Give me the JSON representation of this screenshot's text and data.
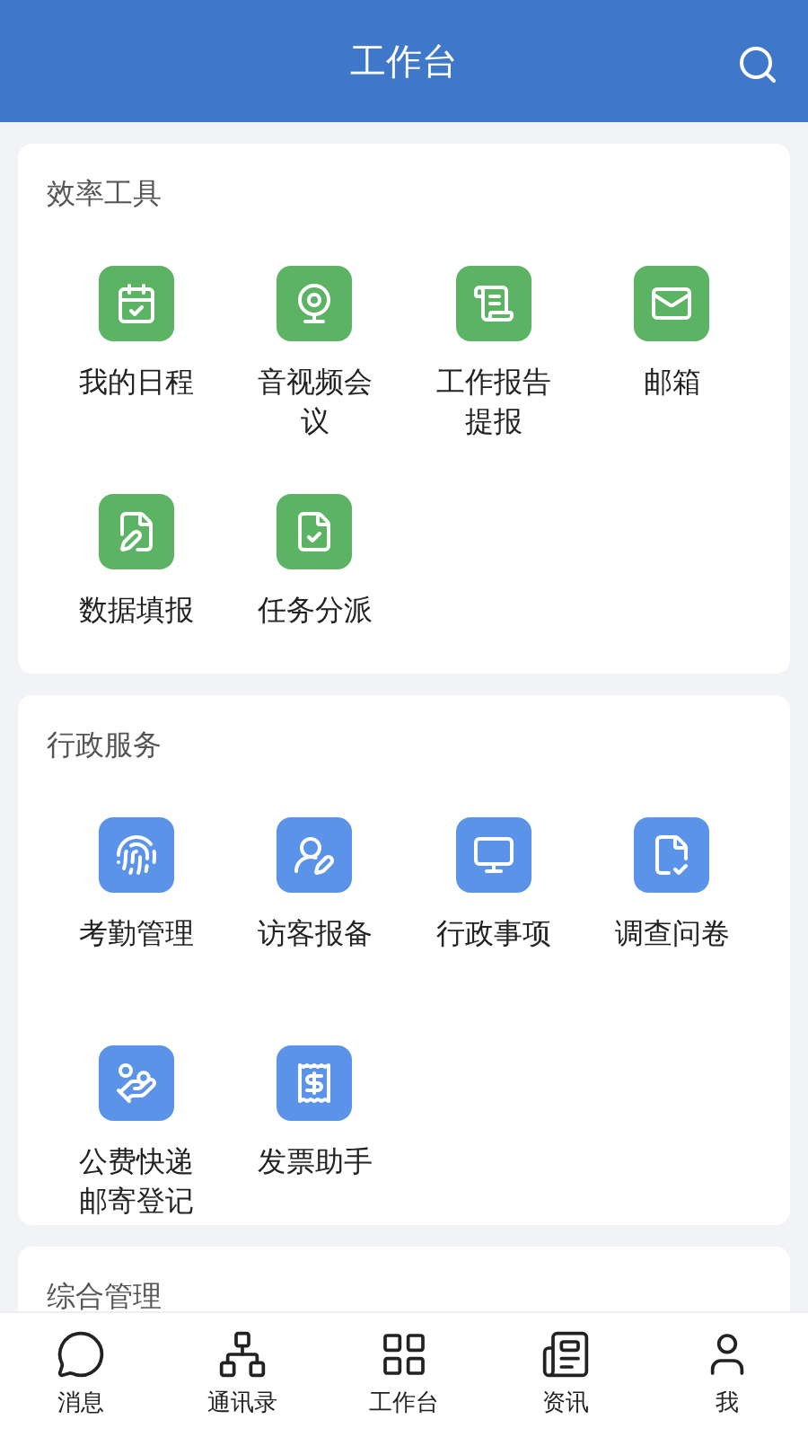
{
  "header": {
    "title": "工作台"
  },
  "sections": [
    {
      "title": "效率工具",
      "color": "#5cb363",
      "items": [
        {
          "label": "我的日程"
        },
        {
          "label": "音视频会议"
        },
        {
          "label": "工作报告提报"
        },
        {
          "label": "邮箱"
        },
        {
          "label": "数据填报"
        },
        {
          "label": "任务分派"
        }
      ]
    },
    {
      "title": "行政服务",
      "color": "#5b93e8",
      "items": [
        {
          "label": "考勤管理"
        },
        {
          "label": "访客报备"
        },
        {
          "label": "行政事项"
        },
        {
          "label": "调查问卷"
        },
        {
          "label": "公费快递邮寄登记"
        },
        {
          "label": "发票助手"
        }
      ]
    },
    {
      "title": "综合管理"
    }
  ],
  "tabbar": [
    {
      "label": "消息",
      "selected": false
    },
    {
      "label": "通讯录",
      "selected": false
    },
    {
      "label": "工作台",
      "selected": false
    },
    {
      "label": "资讯",
      "selected": false
    },
    {
      "label": "我",
      "selected": false
    }
  ]
}
